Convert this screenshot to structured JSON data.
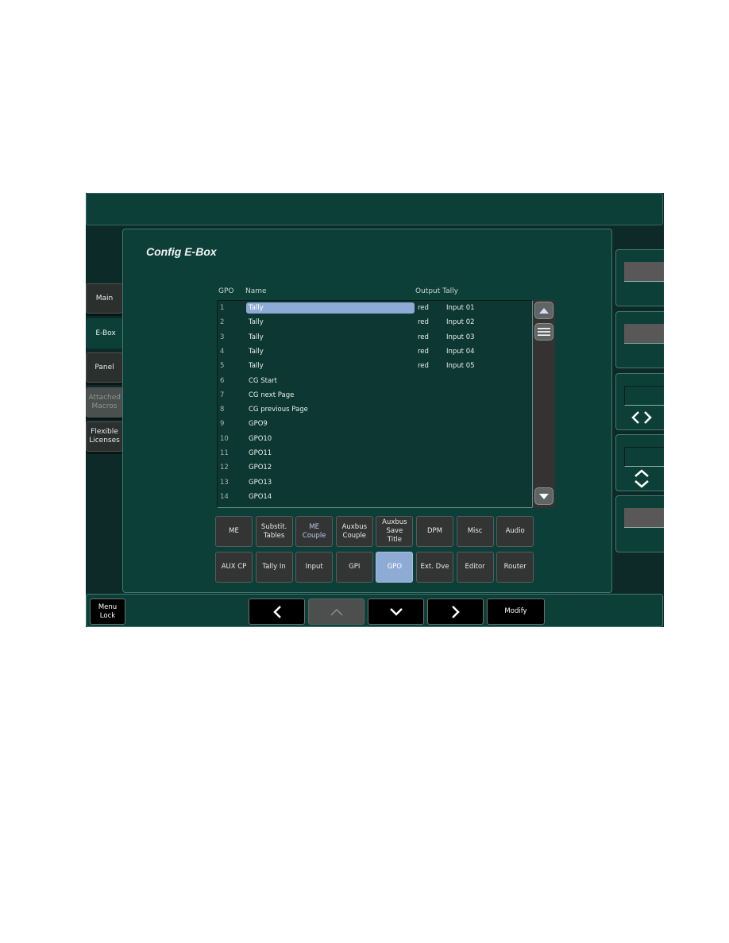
{
  "title": "Config E-Box",
  "side_tabs": [
    {
      "label": "Main",
      "state": "normal"
    },
    {
      "label": "E-Box",
      "state": "active"
    },
    {
      "label": "Panel",
      "state": "normal"
    },
    {
      "label": "Attached Macros",
      "state": "disabled"
    },
    {
      "label": "Flexible Licenses",
      "state": "normal"
    }
  ],
  "table": {
    "headers": {
      "gpo": "GPO",
      "name": "Name",
      "output_tally": "Output Tally"
    },
    "rows": [
      {
        "num": "1",
        "name": "Tally",
        "color": "red",
        "tally": "Input 01",
        "selected": true
      },
      {
        "num": "2",
        "name": "Tally",
        "color": "red",
        "tally": "Input 02"
      },
      {
        "num": "3",
        "name": "Tally",
        "color": "red",
        "tally": "Input 03"
      },
      {
        "num": "4",
        "name": "Tally",
        "color": "red",
        "tally": "Input 04"
      },
      {
        "num": "5",
        "name": "Tally",
        "color": "red",
        "tally": "Input 05"
      },
      {
        "num": "6",
        "name": "CG Start",
        "color": "",
        "tally": ""
      },
      {
        "num": "7",
        "name": "CG next Page",
        "color": "",
        "tally": ""
      },
      {
        "num": "8",
        "name": "CG previous Page",
        "color": "",
        "tally": ""
      },
      {
        "num": "9",
        "name": "GPO9",
        "color": "",
        "tally": ""
      },
      {
        "num": "10",
        "name": "GPO10",
        "color": "",
        "tally": ""
      },
      {
        "num": "11",
        "name": "GPO11",
        "color": "",
        "tally": ""
      },
      {
        "num": "12",
        "name": "GPO12",
        "color": "",
        "tally": ""
      },
      {
        "num": "13",
        "name": "GPO13",
        "color": "",
        "tally": ""
      },
      {
        "num": "14",
        "name": "GPO14",
        "color": "",
        "tally": ""
      }
    ]
  },
  "category_buttons": {
    "row1": [
      {
        "label": "ME",
        "style": "normal"
      },
      {
        "label": "Substit. Tables",
        "style": "normal"
      },
      {
        "label": "ME Couple",
        "style": "blue"
      },
      {
        "label": "Auxbus Couple",
        "style": "normal"
      },
      {
        "label": "Auxbus Save Title",
        "style": "normal"
      },
      {
        "label": "DPM",
        "style": "normal"
      },
      {
        "label": "Misc",
        "style": "normal"
      },
      {
        "label": "Audio",
        "style": "normal"
      }
    ],
    "row2": [
      {
        "label": "AUX CP",
        "style": "normal"
      },
      {
        "label": "Tally In",
        "style": "normal"
      },
      {
        "label": "Input",
        "style": "normal"
      },
      {
        "label": "GPI",
        "style": "normal"
      },
      {
        "label": "GPO",
        "style": "active"
      },
      {
        "label": "Ext. Dve",
        "style": "normal"
      },
      {
        "label": "Editor",
        "style": "normal"
      },
      {
        "label": "Router",
        "style": "normal"
      }
    ]
  },
  "bottom_bar": {
    "menu_lock": "Menu Lock",
    "left_icon": "chevron-left-icon",
    "up_icon": "chevron-up-icon",
    "down_icon": "chevron-down-icon",
    "right_icon": "chevron-right-icon",
    "modify": "Modify"
  },
  "right_panels": [
    {
      "field": "grey",
      "icon": ""
    },
    {
      "field": "grey",
      "icon": ""
    },
    {
      "field": "dark",
      "icon": "left-right-arrows-icon"
    },
    {
      "field": "dark",
      "icon": "up-down-arrows-icon"
    },
    {
      "field": "grey",
      "icon": ""
    }
  ],
  "colors": {
    "background": "#0d3f39",
    "selection": "#8eabd6",
    "button": "#333534"
  }
}
